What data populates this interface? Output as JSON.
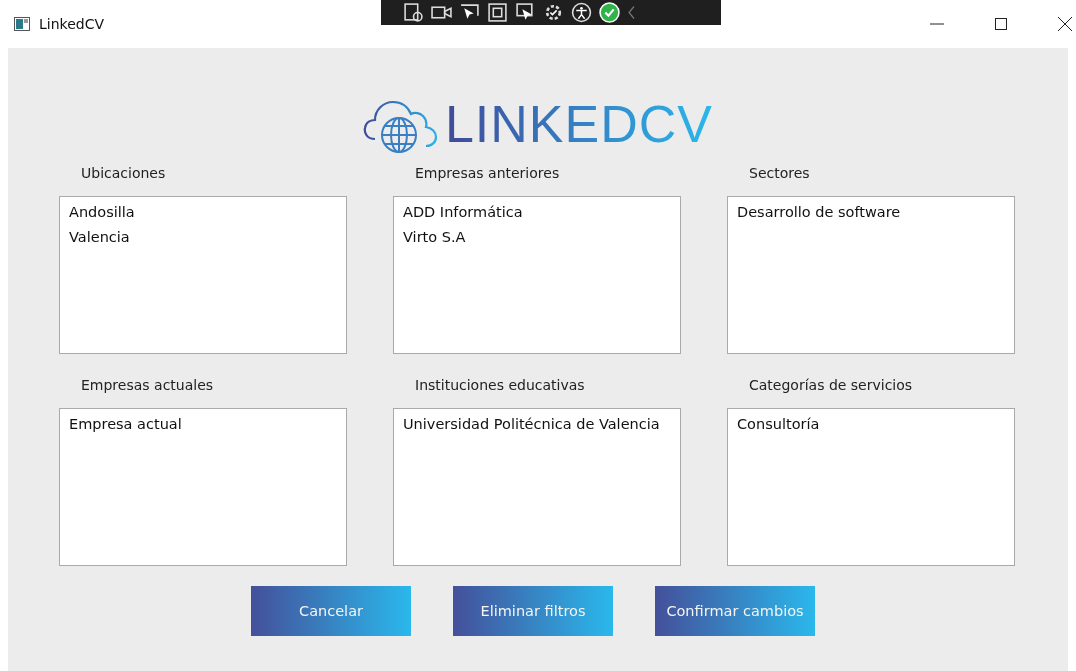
{
  "window": {
    "title": "LinkedCV"
  },
  "logo": {
    "text": "LINKEDCV"
  },
  "lists": [
    {
      "label": "Ubicaciones",
      "items": [
        "Andosilla",
        "Valencia"
      ]
    },
    {
      "label": "Empresas anteriores",
      "items": [
        "ADD Informática",
        "Virto S.A"
      ]
    },
    {
      "label": "Sectores",
      "items": [
        "Desarrollo de software"
      ]
    },
    {
      "label": "Empresas actuales",
      "items": [
        "Empresa actual"
      ]
    },
    {
      "label": "Instituciones educativas",
      "items": [
        "Universidad Politécnica de Valencia"
      ]
    },
    {
      "label": "Categorías de servicios",
      "items": [
        "Consultoría"
      ]
    }
  ],
  "buttons": [
    "Cancelar",
    "Eliminar filtros",
    "Confirmar cambios"
  ]
}
